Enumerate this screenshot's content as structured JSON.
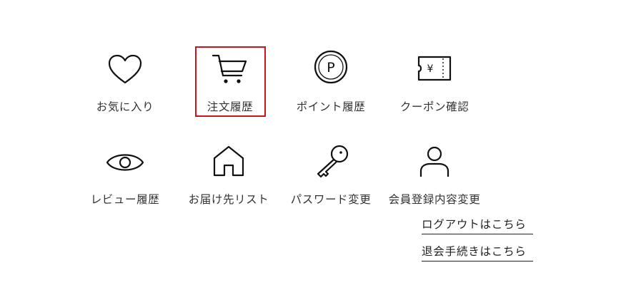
{
  "colors": {
    "highlight": "#d0121b",
    "icon_stroke": "#111111",
    "text": "#333333"
  },
  "menu": {
    "row1": [
      {
        "label": "お気に入り",
        "icon": "heart-icon"
      },
      {
        "label": "注文履歴",
        "icon": "cart-icon",
        "highlighted": true
      },
      {
        "label": "ポイント履歴",
        "icon": "point-coin-icon",
        "coin_letter": "P"
      },
      {
        "label": "クーポン確認",
        "icon": "coupon-ticket-icon",
        "yen": "¥"
      }
    ],
    "row2": [
      {
        "label": "レビュー履歴",
        "icon": "eye-icon"
      },
      {
        "label": "お届け先リスト",
        "icon": "home-icon"
      },
      {
        "label": "パスワード変更",
        "icon": "key-icon"
      },
      {
        "label": "会員登録内容変更",
        "icon": "user-icon"
      }
    ]
  },
  "links": {
    "logout": "ログアウトはこちら",
    "withdraw": "退会手続きはこちら"
  }
}
